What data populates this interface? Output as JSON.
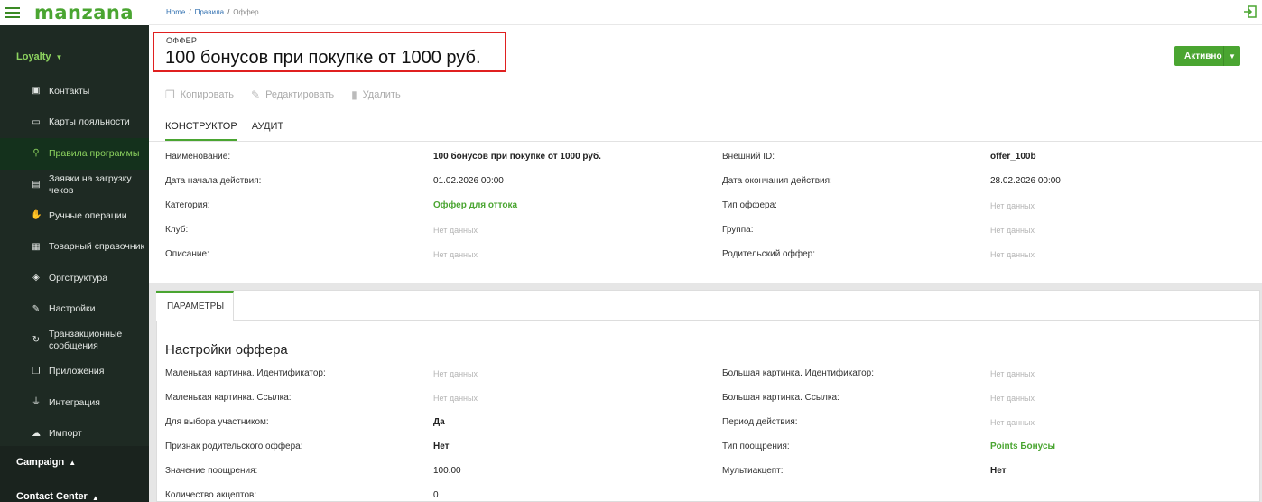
{
  "app": {
    "logo": "manzana"
  },
  "sidebar": {
    "loyalty_label": "Loyalty",
    "items": [
      {
        "label": "Контакты",
        "icon": "contact-card-icon"
      },
      {
        "label": "Карты лояльности",
        "icon": "credit-card-icon"
      },
      {
        "label": "Правила программы",
        "icon": "rules-share-icon"
      },
      {
        "label": "Заявки на загрузку чеков",
        "icon": "receipt-icon"
      },
      {
        "label": "Ручные операции",
        "icon": "hand-icon"
      },
      {
        "label": "Товарный справочник",
        "icon": "grid-icon"
      },
      {
        "label": "Оргструктура",
        "icon": "layers-icon"
      },
      {
        "label": "Настройки",
        "icon": "wrench-icon"
      },
      {
        "label": "Транзакционные сообщения",
        "icon": "sync-icon"
      },
      {
        "label": "Приложения",
        "icon": "copy-icon"
      },
      {
        "label": "Интеграция",
        "icon": "plug-icon"
      },
      {
        "label": "Импорт",
        "icon": "cloud-upload-icon"
      }
    ],
    "campaign_label": "Campaign",
    "contact_center_label": "Contact Center"
  },
  "breadcrumb": {
    "home": "Home",
    "rules": "Правила",
    "current": "Оффер"
  },
  "header": {
    "overline": "ОФФЕР",
    "title": "100 бонусов при покупке от 1000 руб.",
    "status_label": "Активно"
  },
  "actions": {
    "copy": "Копировать",
    "edit": "Редактировать",
    "delete": "Удалить"
  },
  "tabs": {
    "constructor": "КОНСТРУКТОР",
    "audit": "АУДИТ"
  },
  "details": {
    "name_label": "Наименование:",
    "name_value": "100 бонусов при покупке от 1000 руб.",
    "external_id_label": "Внешний ID:",
    "external_id_value": "offer_100b",
    "start_label": "Дата начала действия:",
    "start_value": "01.02.2026 00:00",
    "end_label": "Дата окончания действия:",
    "end_value": "28.02.2026 00:00",
    "category_label": "Категория:",
    "category_value": "Оффер для оттока",
    "offer_type_label": "Тип оффера:",
    "offer_type_value": "Нет данных",
    "club_label": "Клуб:",
    "club_value": "Нет данных",
    "group_label": "Группа:",
    "group_value": "Нет данных",
    "description_label": "Описание:",
    "description_value": "Нет данных",
    "parent_label": "Родительский оффер:",
    "parent_value": "Нет данных"
  },
  "params": {
    "tab_label": "ПАРАМЕТРЫ",
    "section_title": "Настройки оффера",
    "small_img_id_label": "Маленькая картинка. Идентификатор:",
    "small_img_id_value": "Нет данных",
    "big_img_id_label": "Большая картинка. Идентификатор:",
    "big_img_id_value": "Нет данных",
    "small_img_link_label": "Маленькая картинка. Ссылка:",
    "small_img_link_value": "Нет данных",
    "big_img_link_label": "Большая картинка. Ссылка:",
    "big_img_link_value": "Нет данных",
    "member_choice_label": "Для выбора участником:",
    "member_choice_value": "Да",
    "period_label": "Период действия:",
    "period_value": "Нет данных",
    "parent_flag_label": "Признак родительского оффера:",
    "parent_flag_value": "Нет",
    "reward_type_label": "Тип поощрения:",
    "reward_type_value": "Points Бонусы",
    "reward_value_label": "Значение поощрения:",
    "reward_value_value": "100.00",
    "multiaccept_label": "Мультиакцепт:",
    "multiaccept_value": "Нет",
    "accept_count_label": "Количество акцептов:",
    "accept_count_value": "0"
  }
}
